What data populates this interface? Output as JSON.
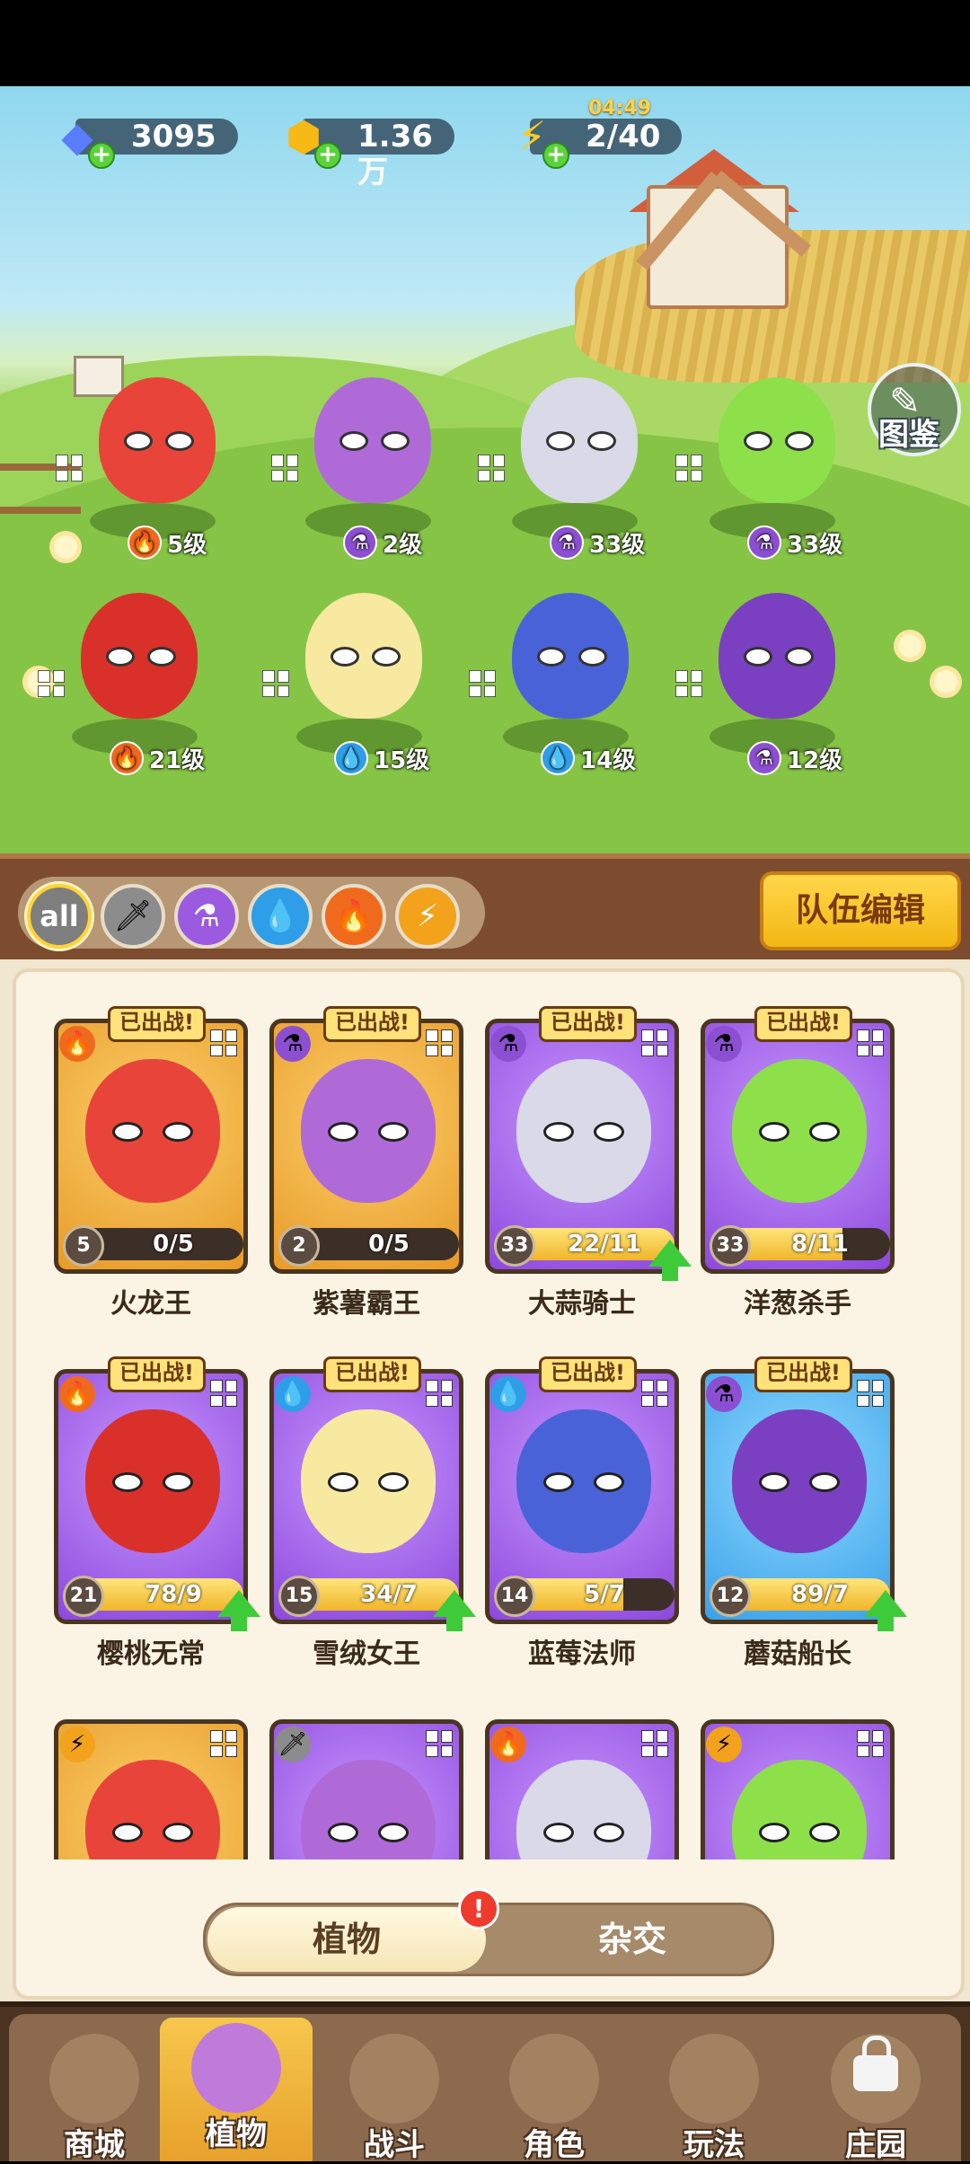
{
  "resources": {
    "gems": {
      "value": "3095",
      "icon": "gem-icon",
      "color": "#5a7cff"
    },
    "gold": {
      "value": "1.36万",
      "icon": "gold-coin-icon",
      "color": "#f6b916"
    },
    "energy": {
      "value": "2/40",
      "icon": "lightning-icon",
      "color": "#ffcc1f"
    },
    "energy_timer": "04:49"
  },
  "codex": {
    "label": "图鉴",
    "icon": "book-icon"
  },
  "team_field": [
    {
      "element": "fire",
      "level": "5级"
    },
    {
      "element": "poison",
      "level": "2级"
    },
    {
      "element": "poison",
      "level": "33级"
    },
    {
      "element": "poison",
      "level": "33级"
    },
    {
      "element": "fire",
      "level": "21级"
    },
    {
      "element": "water",
      "level": "15级"
    },
    {
      "element": "water",
      "level": "14级"
    },
    {
      "element": "poison",
      "level": "12级"
    }
  ],
  "filters": {
    "all_label": "all",
    "items": [
      "all",
      "sword",
      "poison",
      "water",
      "fire",
      "lightning"
    ]
  },
  "team_edit_label": "队伍编辑",
  "cards": [
    {
      "name": "火龙王",
      "level": "5",
      "progress": "0/5",
      "fill": 0,
      "bg": "gold",
      "element": "fire",
      "deployed": "已出战!",
      "upgradable": false
    },
    {
      "name": "紫薯霸王",
      "level": "2",
      "progress": "0/5",
      "fill": 0,
      "bg": "gold",
      "element": "poison",
      "deployed": "已出战!",
      "upgradable": false
    },
    {
      "name": "大蒜骑士",
      "level": "33",
      "progress": "22/11",
      "fill": 1,
      "bg": "purple",
      "element": "poison",
      "deployed": "已出战!",
      "upgradable": true
    },
    {
      "name": "洋葱杀手",
      "level": "33",
      "progress": "8/11",
      "fill": 0.73,
      "bg": "purple",
      "element": "poison",
      "deployed": "已出战!",
      "upgradable": false
    },
    {
      "name": "樱桃无常",
      "level": "21",
      "progress": "78/9",
      "fill": 1,
      "bg": "purple",
      "element": "fire",
      "deployed": "已出战!",
      "upgradable": true
    },
    {
      "name": "雪绒女王",
      "level": "15",
      "progress": "34/7",
      "fill": 1,
      "bg": "purple",
      "element": "water",
      "deployed": "已出战!",
      "upgradable": true
    },
    {
      "name": "蓝莓法师",
      "level": "14",
      "progress": "5/7",
      "fill": 0.71,
      "bg": "purple",
      "element": "water",
      "deployed": "已出战!",
      "upgradable": false
    },
    {
      "name": "蘑菇船长",
      "level": "12",
      "progress": "89/7",
      "fill": 1,
      "bg": "blue",
      "element": "poison",
      "deployed": "已出战!",
      "upgradable": true
    },
    {
      "name": "",
      "bg": "gold",
      "element": "lightning"
    },
    {
      "name": "",
      "bg": "purple",
      "element": "sword"
    },
    {
      "name": "",
      "bg": "purple",
      "element": "fire"
    },
    {
      "name": "",
      "bg": "purple",
      "element": "lightning"
    }
  ],
  "toggle": {
    "left": "植物",
    "right": "杂交",
    "alert": "!"
  },
  "nav": [
    {
      "label": "商城",
      "icon": "shop-icon"
    },
    {
      "label": "植物",
      "icon": "plant-icon",
      "active": true
    },
    {
      "label": "战斗",
      "icon": "battle-icon"
    },
    {
      "label": "角色",
      "icon": "character-icon"
    },
    {
      "label": "玩法",
      "icon": "gameplay-icon"
    },
    {
      "label": "庄园",
      "icon": "manor-icon",
      "locked": true
    }
  ]
}
